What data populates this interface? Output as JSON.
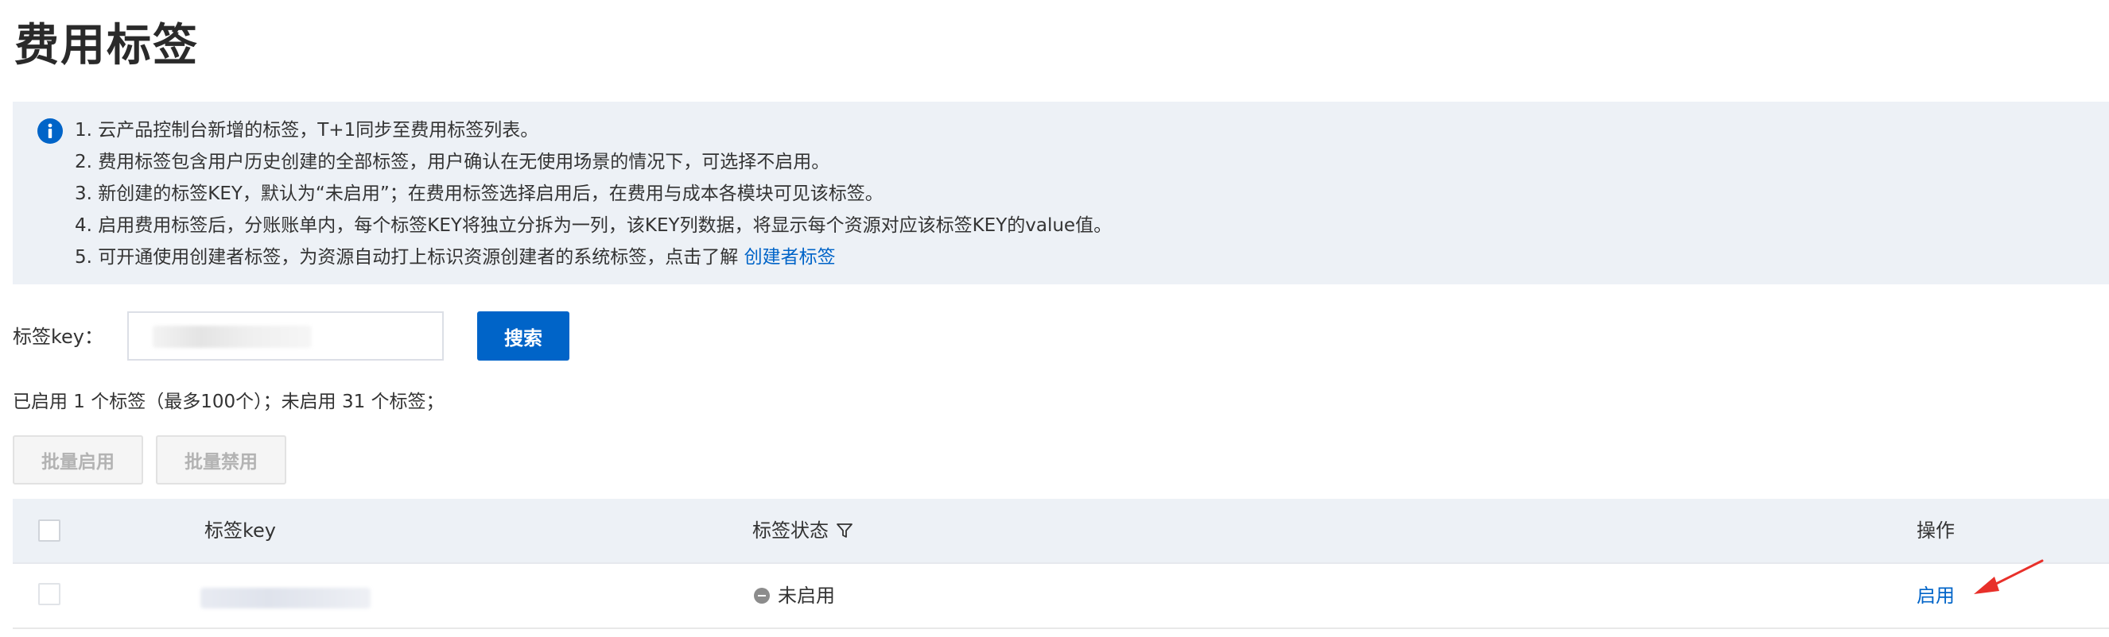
{
  "page": {
    "title": "费用标签"
  },
  "notice": {
    "icon": "info-circle-icon",
    "lines": [
      "1. 云产品控制台新增的标签，T+1同步至费用标签列表。",
      "2. 费用标签包含用户历史创建的全部标签，用户确认在无使用场景的情况下，可选择不启用。",
      "3. 新创建的标签KEY，默认为“未启用”；在费用标签选择启用后，在费用与成本各模块可见该标签。",
      "4. 启用费用标签后，分账账单内，每个标签KEY将独立分拆为一列，该KEY列数据，将显示每个资源对应该标签KEY的value值。"
    ],
    "line5_text": "5. 可开通使用创建者标签，为资源自动打上标识资源创建者的系统标签，点击了解 ",
    "line5_link": "创建者标签"
  },
  "search": {
    "label": "标签key：",
    "button": "搜索"
  },
  "summary": "已启用 1 个标签（最多100个）；未启用 31 个标签；",
  "batch": {
    "enable": "批量启用",
    "disable": "批量禁用"
  },
  "table": {
    "headers": {
      "key": "标签key",
      "status": "标签状态",
      "operation": "操作"
    },
    "rows": [
      {
        "status": "未启用",
        "action": "启用"
      }
    ]
  },
  "colors": {
    "primary": "#0064c8",
    "notice_bg": "#edf1f6",
    "annotation_arrow": "#e8302a"
  }
}
